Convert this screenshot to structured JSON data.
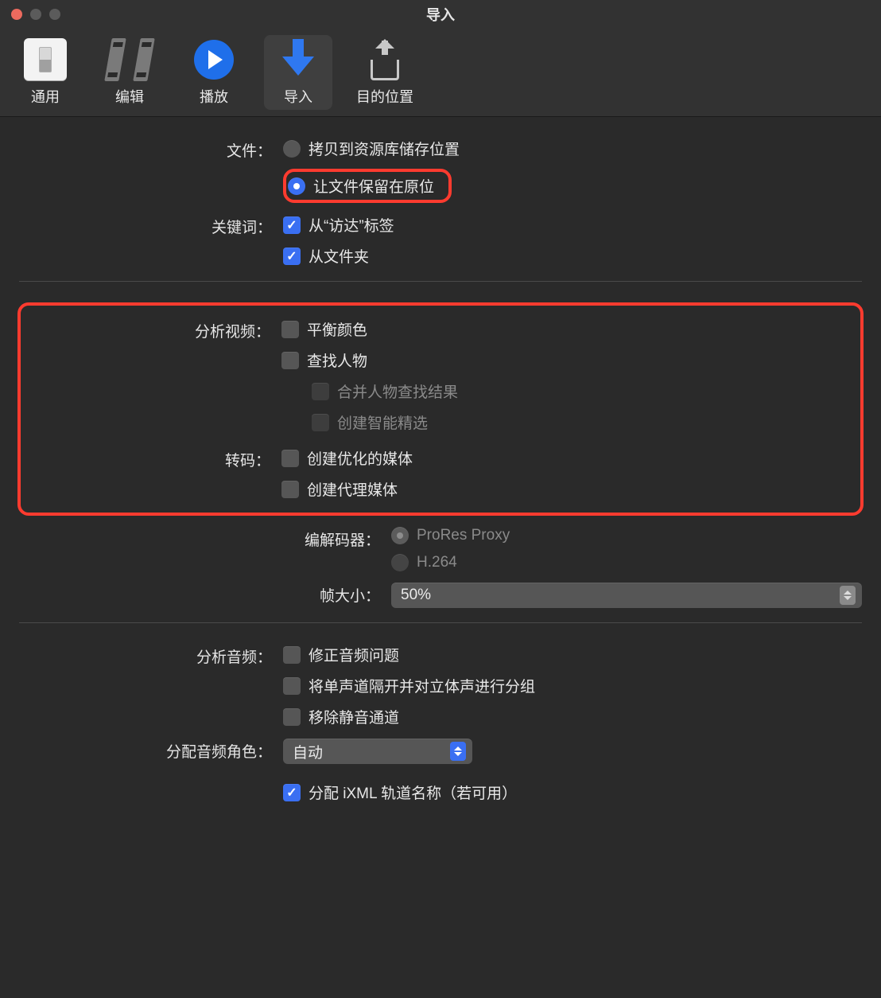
{
  "window": {
    "title": "导入"
  },
  "toolbar": {
    "general": "通用",
    "edit": "编辑",
    "playback": "播放",
    "import": "导入",
    "destinations": "目的位置"
  },
  "files": {
    "label": "文件：",
    "copy_to_library": "拷贝到资源库储存位置",
    "leave_in_place": "让文件保留在原位"
  },
  "keywords": {
    "label": "关键词：",
    "from_finder_tags": "从“访达”标签",
    "from_folders": "从文件夹"
  },
  "analyze_video": {
    "label": "分析视频：",
    "balance_color": "平衡颜色",
    "find_people": "查找人物",
    "consolidate_people": "合并人物查找结果",
    "create_smart_collections": "创建智能精选"
  },
  "transcode": {
    "label": "转码：",
    "create_optimized": "创建优化的媒体",
    "create_proxy": "创建代理媒体"
  },
  "codec": {
    "label": "编解码器：",
    "prores_proxy": "ProRes Proxy",
    "h264": "H.264"
  },
  "frame_size": {
    "label": "帧大小：",
    "value": "50%"
  },
  "analyze_audio": {
    "label": "分析音频：",
    "fix_audio_problems": "修正音频问题",
    "separate_mono_group_stereo": "将单声道隔开并对立体声进行分组",
    "remove_silent_channels": "移除静音通道"
  },
  "assign_audio_role": {
    "label": "分配音频角色：",
    "value": "自动",
    "assign_ixml": "分配 iXML 轨道名称（若可用）"
  }
}
